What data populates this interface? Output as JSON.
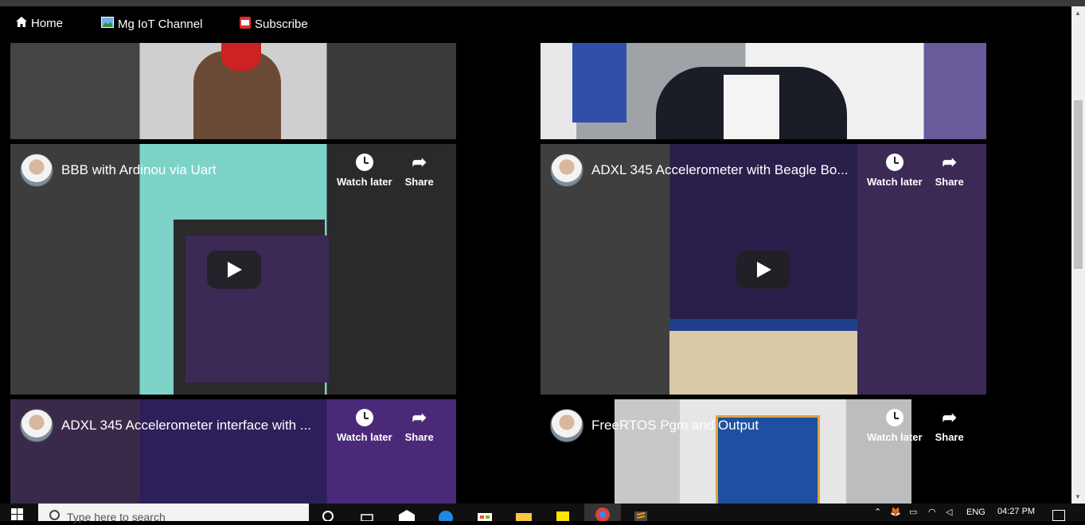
{
  "nav": {
    "home": "Home",
    "channel": "Mg IoT Channel",
    "subscribe": "Subscribe"
  },
  "videos": [
    {
      "title": "BBB with Ardinou via Uart"
    },
    {
      "title": "ADXL 345 Accelerometer with Beagle Bo..."
    },
    {
      "title": "ADXL 345 Accelerometer interface with ..."
    },
    {
      "title": "FreeRTOS Pgm and Output"
    }
  ],
  "actions": {
    "watch_later": "Watch later",
    "share": "Share"
  },
  "taskbar": {
    "search_placeholder": "Type here to search",
    "lang": "ENG",
    "time": "04:27 PM"
  },
  "icons": [
    "home-icon",
    "image-icon",
    "youtube-icon",
    "clock-icon",
    "share-icon",
    "play-icon",
    "windows-icon",
    "search-icon",
    "task-view-icon",
    "mail-icon",
    "edge-icon",
    "store-icon",
    "folder-icon",
    "sticky-notes-icon",
    "chrome-icon",
    "sublime-icon"
  ],
  "colors": {
    "background": "#000000",
    "accent": "#ff0000"
  }
}
